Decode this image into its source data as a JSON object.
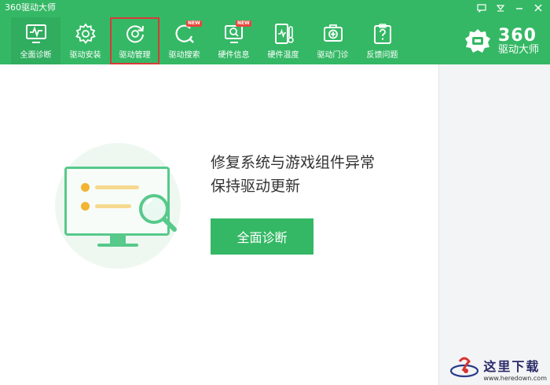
{
  "window": {
    "title": "360驱动大师",
    "controls": [
      "message-icon",
      "menu-icon",
      "minimize-icon",
      "close-icon"
    ]
  },
  "toolbar": {
    "items": [
      {
        "label": "全面诊断",
        "icon": "monitor-pulse-icon",
        "state": "active"
      },
      {
        "label": "驱动安装",
        "icon": "gear-icon"
      },
      {
        "label": "驱动管理",
        "icon": "refresh-gear-icon",
        "state": "selected"
      },
      {
        "label": "驱动搜索",
        "icon": "search-icon",
        "badge": "NEW"
      },
      {
        "label": "硬件信息",
        "icon": "hardware-search-icon",
        "badge": "NEW"
      },
      {
        "label": "硬件温度",
        "icon": "thermometer-icon"
      },
      {
        "label": "驱动门诊",
        "icon": "medical-kit-icon"
      },
      {
        "label": "反馈问题",
        "icon": "question-clipboard-icon"
      }
    ]
  },
  "brand": {
    "number": "360",
    "name": "驱动大师"
  },
  "hero": {
    "line1": "修复系统与游戏组件异常",
    "line2": "保持驱动更新",
    "button_label": "全面诊断"
  },
  "watermark": {
    "cn": "这里下载",
    "url": "www.heredown.com"
  },
  "colors": {
    "brand_green": "#35b865",
    "highlight_red": "#d83a3a",
    "badge_red": "#e8453c",
    "accent_yellow": "#f2b431"
  }
}
